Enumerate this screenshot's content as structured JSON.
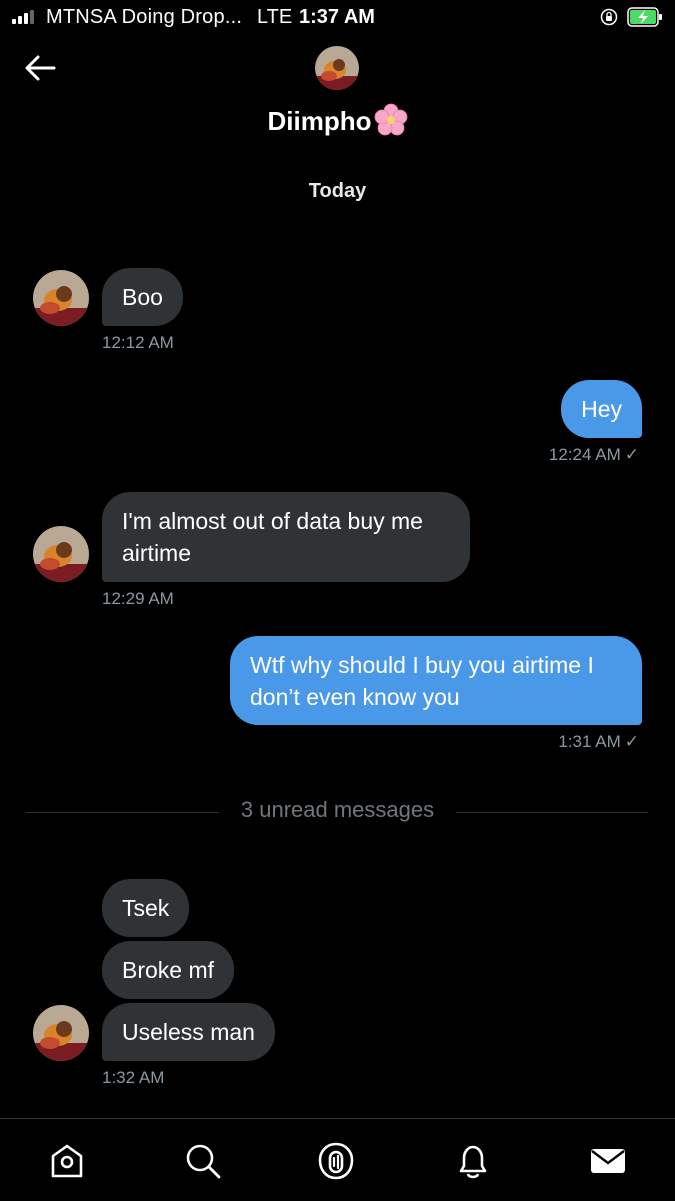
{
  "status_bar": {
    "carrier": "MTNSA Doing Drop...",
    "network": "LTE",
    "time": "1:37 AM"
  },
  "header": {
    "contact_name": "Diimpho",
    "name_emoji": "cherry-blossom-icon"
  },
  "day_label": "Today",
  "messages": [
    {
      "direction": "in",
      "text": "Boo",
      "time": "12:12 AM"
    },
    {
      "direction": "out",
      "text": "Hey",
      "time": "12:24 AM"
    },
    {
      "direction": "in",
      "text": "I'm almost out of data buy me airtime",
      "time": "12:29 AM"
    },
    {
      "direction": "out",
      "text": "Wtf why should I buy you airtime I don’t even know you",
      "time": "1:31 AM"
    },
    {
      "direction": "in",
      "text": "Tsek"
    },
    {
      "direction": "in",
      "text": "Broke mf"
    },
    {
      "direction": "in",
      "text": "Useless man",
      "time": "1:32 AM"
    }
  ],
  "unread_divider": "3 unread messages",
  "bottom_nav": [
    "home-icon",
    "search-icon",
    "spaces-icon",
    "notifications-icon",
    "messages-icon"
  ],
  "colors": {
    "background": "#000000",
    "incoming_bubble": "#2f3336",
    "outgoing_bubble": "#4a99e9",
    "timestamp": "#8b98a5",
    "battery": "#4cd964"
  }
}
